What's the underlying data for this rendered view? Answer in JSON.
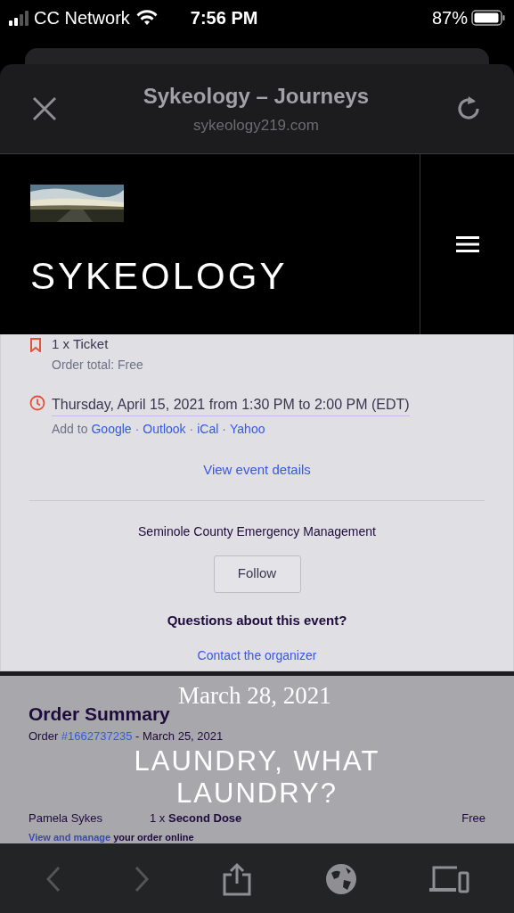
{
  "status_bar": {
    "carrier": "CC Network",
    "time": "7:56 PM",
    "battery": "87%"
  },
  "browser": {
    "title": "Sykeology – Journeys",
    "url": "sykeology219.com"
  },
  "site_header": {
    "logo_text": "SYKEOLOGY"
  },
  "ticket": {
    "quantity": "1 x Ticket",
    "order_total": "Order total: Free"
  },
  "event_time": {
    "when": "Thursday, April 15, 2021 from 1:30 PM to 2:00 PM (EDT)",
    "add_to": "Add to",
    "calendars": [
      "Google",
      "Outlook",
      "iCal",
      "Yahoo"
    ],
    "separator": "·"
  },
  "view_details": "View event details",
  "organizer": {
    "name": "Seminole County Emergency Management",
    "follow": "Follow",
    "question": "Questions about this event?",
    "contact": "Contact the organizer"
  },
  "order_summary": {
    "title": "Order Summary",
    "order_label": "Order",
    "order_number": "#1662737235",
    "order_date": "- March 25, 2021",
    "attendee": "Pamela Sykes",
    "item_qty": "1 x",
    "item_name": "Second Dose",
    "price": "Free",
    "manage_link": "View and manage",
    "manage_rest": "your order online"
  },
  "post": {
    "date": "March 28, 2021",
    "title": "LAUNDRY, WHAT LAUNDRY?"
  }
}
